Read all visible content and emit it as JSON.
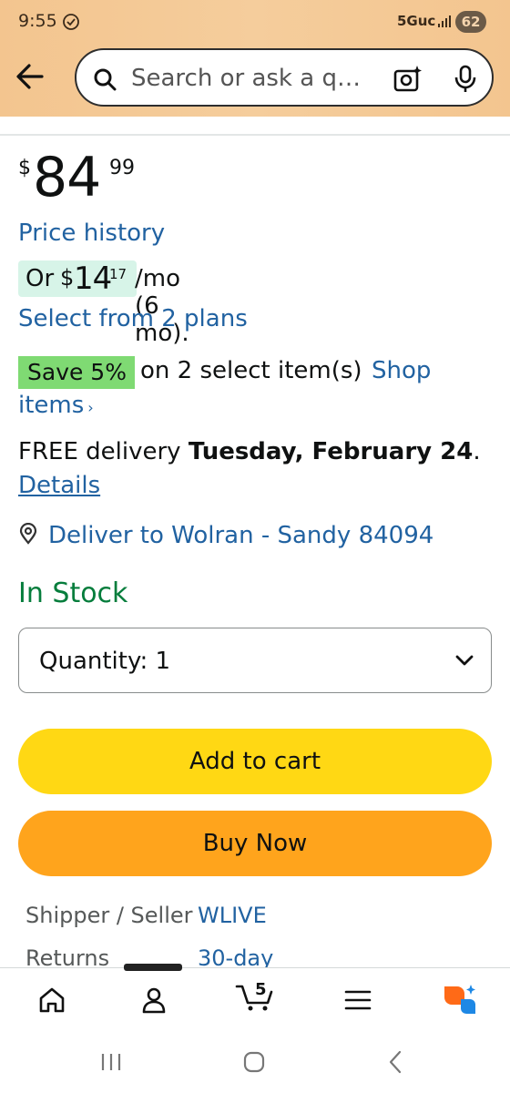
{
  "status_bar": {
    "time": "9:55",
    "network": "5Guc",
    "battery": "62"
  },
  "search": {
    "placeholder": "Search or ask a q…"
  },
  "product": {
    "price_symbol": "$",
    "price_whole": "84",
    "price_fraction": "99",
    "price_history_link": "Price history",
    "installment": {
      "prefix": "Or",
      "symbol": "$",
      "whole": "14",
      "fraction": "17",
      "suffix": "/mo (6 mo)."
    },
    "plans_link": "Select from 2 plans",
    "promo": {
      "badge": "Save 5%",
      "text": "on 2 select item(s)",
      "link_line1": "Shop",
      "link_line2": "items",
      "link_chevron": "›"
    },
    "delivery": {
      "prefix": "FREE delivery",
      "date": "Tuesday, February 24",
      "suffix": ".",
      "details_link": "Details"
    },
    "deliver_to": "Deliver to Wolran - Sandy 84094",
    "stock_status": "In Stock",
    "quantity_label": "Quantity: 1",
    "add_to_cart": "Add to cart",
    "buy_now": "Buy Now",
    "info": [
      {
        "label": "Shipper / Seller",
        "value": "WLIVE"
      },
      {
        "label": "Returns",
        "value": "30-day"
      }
    ]
  },
  "bottom_nav": {
    "cart_count": "5",
    "items": [
      "home-icon",
      "account-icon",
      "cart-icon",
      "menu-icon",
      "rufus-icon"
    ]
  },
  "colors": {
    "link": "#2162a1",
    "add_to_cart": "#ffd814",
    "buy_now": "#ffa41c",
    "in_stock": "#067d3c",
    "save_badge": "#7fda73",
    "installment_badge": "#d7f4e8",
    "header": "#f5cd9c"
  }
}
